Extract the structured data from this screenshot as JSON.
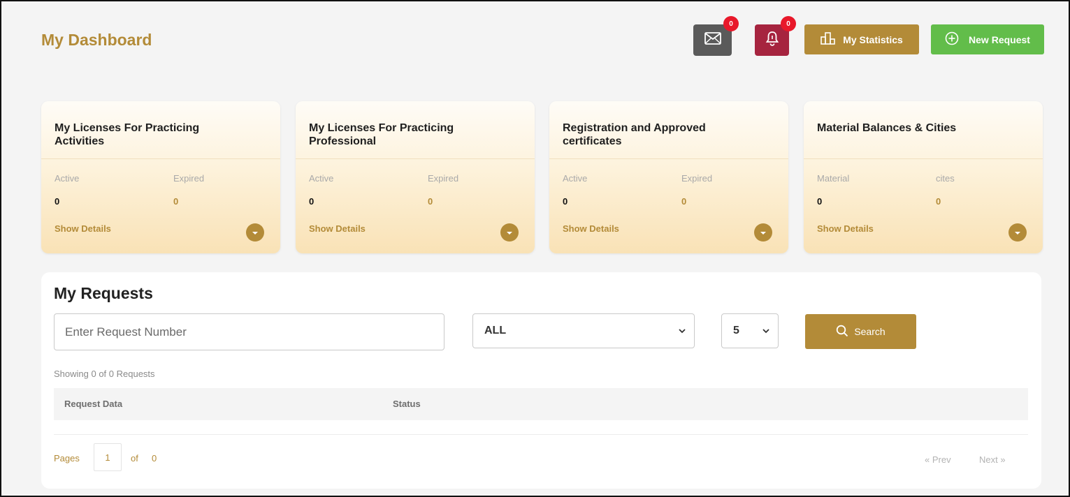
{
  "header": {
    "title": "My Dashboard",
    "mail_badge": "0",
    "bell_badge": "0",
    "stats_label": "My Statistics",
    "new_request_label": "New Request"
  },
  "colors": {
    "gold": "#b38b38",
    "green": "#62bd4a",
    "grey_button": "#5a5a5a",
    "maroon_button": "#a6243f",
    "badge_red": "#e8182a"
  },
  "icons": {
    "mail": "envelope-icon",
    "bell": "bell-icon",
    "stats": "bar-chart-icon",
    "new_request": "plus-circle-icon",
    "card_toggle": "chevron-down-icon",
    "search": "search-icon",
    "select_arrow": "chevron-down-icon"
  },
  "cards": [
    {
      "title": "My Licenses For Practicing Activities",
      "label1": "Active",
      "label2": "Expired",
      "value1": "0",
      "value2": "0",
      "link": "Show Details"
    },
    {
      "title": "My Licenses For Practicing Professional",
      "label1": "Active",
      "label2": "Expired",
      "value1": "0",
      "value2": "0",
      "link": "Show Details"
    },
    {
      "title": "Registration and Approved certificates",
      "label1": "Active",
      "label2": "Expired",
      "value1": "0",
      "value2": "0",
      "link": "Show Details"
    },
    {
      "title": "Material Balances & Cities",
      "label1": "Material",
      "label2": "cites",
      "value1": "0",
      "value2": "0",
      "link": "Show Details"
    }
  ],
  "requests": {
    "title": "My Requests",
    "search_placeholder": "Enter Request Number",
    "status_filter": "ALL",
    "page_size": "5",
    "search_button": "Search",
    "showing_text": "Showing 0 of 0 Requests",
    "columns": [
      "Request Data",
      "Status"
    ],
    "pager": {
      "pages_label": "Pages",
      "current_page": "1",
      "of_label": "of",
      "total_pages": "0",
      "prev_label": "« Prev",
      "next_label": "Next »"
    }
  }
}
